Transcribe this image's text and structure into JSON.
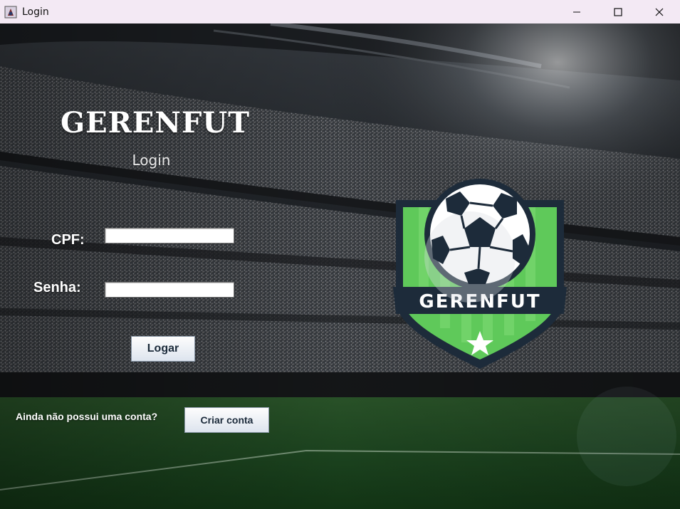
{
  "window": {
    "title": "Login",
    "icon": "java-app-icon",
    "controls": [
      "minimize-icon",
      "maximize-icon",
      "close-icon"
    ]
  },
  "login": {
    "brand_title": "GERENFUT",
    "subtitle": "Login",
    "cpf_label": "CPF:",
    "cpf_value": "",
    "senha_label": "Senha:",
    "senha_value": "",
    "login_button": "Logar",
    "no_account_text": "Ainda não possui uma conta?",
    "create_account_button": "Criar conta"
  },
  "logo": {
    "text": "GERENFUT",
    "icons": [
      "soccer-ball-icon",
      "star-icon"
    ],
    "colors": {
      "shield_green": "#5fc95a",
      "shield_dark": "#1d2b3a",
      "ball_white": "#ffffff"
    }
  }
}
